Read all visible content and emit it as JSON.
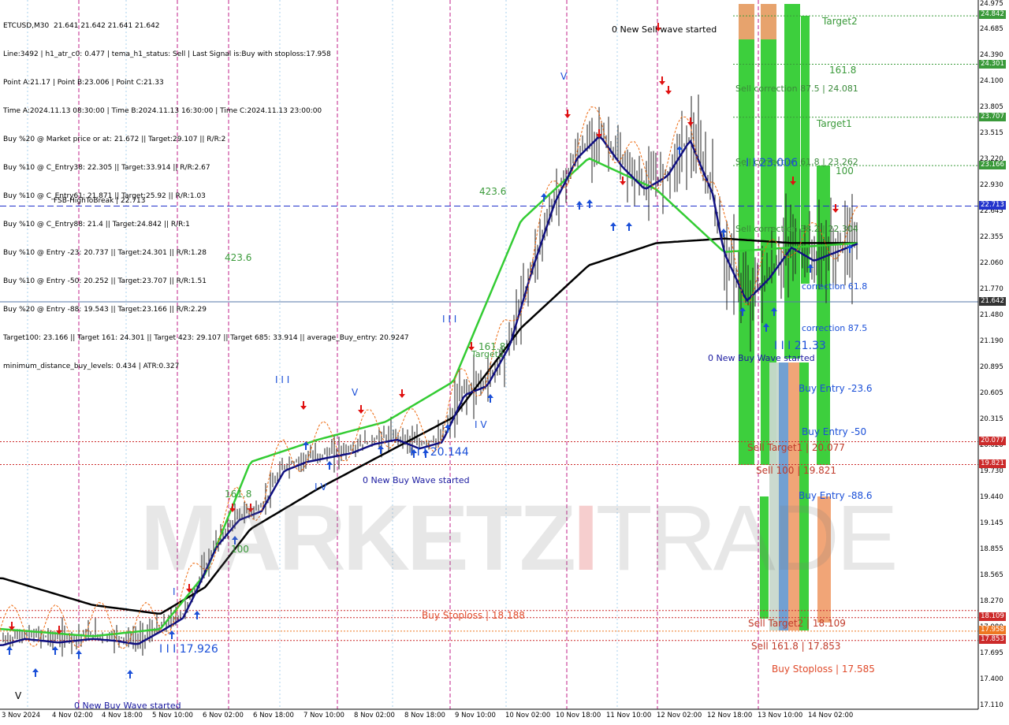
{
  "info_lines": [
    "ETCUSD,M30  21.641 21.642 21.641 21.642",
    "Line:3492 | h1_atr_c0: 0.477 | tema_h1_status: Sell | Last Signal is:Buy with stoploss:17.958",
    "Point A:21.17 | Point B:23.006 | Point C:21.33",
    "Time A:2024.11.13 08:30:00 | Time B:2024.11.13 16:30:00 | Time C:2024.11.13 23:00:00",
    "Buy %20 @ Market price or at: 21.672 || Target:29.107 || R/R:2",
    "Buy %10 @ C_Entry38: 22.305 || Target:33.914 || R/R:2.67",
    "Buy %10 @ C_Entry61: 21.871 || Target:25.92 || R/R:1.03",
    "Buy %10 @ C_Entry88: 21.4 || Target:24.842 || R/R:1",
    "Buy %10 @ Entry -23: 20.737 || Target:24.301 || R/R:1.28",
    "Buy %10 @ Entry -50: 20.252 || Target:23.707 || R/R:1.51",
    "Buy %20 @ Entry -88: 19.543 || Target:23.166 || R/R:2.29",
    "Target100: 23.166 || Target 161: 24.301 || Target 423: 29.107 || Target 685: 33.914 || average_Buy_entry: 20.9247",
    "minimum_distance_buy_levels: 0.434 | ATR:0.327"
  ],
  "y_axis": [
    "24.975",
    "24.685",
    "24.390",
    "24.100",
    "23.805",
    "23.515",
    "23.220",
    "22.930",
    "22.645",
    "22.355",
    "22.060",
    "21.770",
    "21.480",
    "21.190",
    "20.895",
    "20.605",
    "20.315",
    "20.020",
    "19.730",
    "19.440",
    "19.145",
    "18.855",
    "18.565",
    "18.270",
    "17.980",
    "17.695",
    "17.400",
    "17.110"
  ],
  "x_axis": [
    "3 Nov 2024",
    "4 Nov 02:00",
    "4 Nov 18:00",
    "5 Nov 10:00",
    "6 Nov 02:00",
    "6 Nov 18:00",
    "7 Nov 10:00",
    "8 Nov 02:00",
    "8 Nov 18:00",
    "9 Nov 10:00",
    "10 Nov 02:00",
    "10 Nov 18:00",
    "11 Nov 10:00",
    "12 Nov 02:00",
    "12 Nov 18:00",
    "13 Nov 10:00",
    "14 Nov 02:00"
  ],
  "price_tags": [
    {
      "value": "24.842",
      "color": "#3a9a3a"
    },
    {
      "value": "24.301",
      "color": "#3a9a3a"
    },
    {
      "value": "23.707",
      "color": "#3a9a3a"
    },
    {
      "value": "23.166",
      "color": "#3a9a3a"
    },
    {
      "value": "22.713",
      "color": "#2233cc"
    },
    {
      "value": "21.642",
      "color": "#333333"
    },
    {
      "value": "20.077",
      "color": "#cc2a2a"
    },
    {
      "value": "19.821",
      "color": "#cc2a2a"
    },
    {
      "value": "18.109",
      "color": "#cc2a2a"
    },
    {
      "value": "17.958",
      "color": "#ee7722"
    },
    {
      "value": "17.853",
      "color": "#cc2a2a"
    }
  ],
  "annotations": {
    "new_sell_wave": "0 New Sell wave started",
    "target2": "Target2",
    "fib_161_top": "161.8",
    "sell_corr_875": "Sell correction 87.5 | 24.081",
    "target1": "Target1",
    "sell_corr_61": "Sell correction 61.8 | 23.262",
    "point_b": "I I 23.006",
    "fib_100": "100",
    "fsb": "FSB-HighToBreak | 22.713",
    "fib_4236_a": "423.6",
    "fib_4236_b": "423.6",
    "sell_corr_382": "Sell correction 38.2 | 22.304",
    "corr_618": "correction 61.8",
    "corr_875": "correction 87.5",
    "point_c": "I I I 21.33",
    "new_buy_wave_3": "0 New Buy Wave started",
    "buy_entry_23": "Buy Entry -23.6",
    "buy_entry_50": "Buy Entry -50",
    "sell_target1": "Sell Target1 | 20.077",
    "sell_100": "Sell 100 | 19.821",
    "buy_entry_88": "Buy Entry -88.6",
    "buy_stoploss_left": "Buy Stoploss | 18.188",
    "sell_target2": "Sell Target2 | 18.109",
    "sell_1618": "Sell 161.8 | 17.853",
    "buy_stoploss_right": "Buy Stoploss | 17.585",
    "fib_1618_mid": "161.8",
    "target2_mid": "Target2",
    "wave_iii_mid": "I I I",
    "wave_iv_mid": "I V",
    "wave_v_mid": "V",
    "wave_iii_left": "I I I",
    "wave_iv_left": "I V",
    "val_20144": "I I I 20.144",
    "new_buy_wave_2": "0 New Buy Wave started",
    "fib_1618_left": "161.8",
    "fib_100_left": "100",
    "val_17926": "I I I 17.926",
    "wave_i": "I",
    "new_buy_wave_1": "0 New Buy Wave started",
    "wave_v_bottom": "V",
    "wave_v_top": "V"
  },
  "watermark": {
    "part1": "MARKETZ",
    "part2": "I",
    "part3": "TRADE"
  },
  "colors": {
    "green_bar": "#33cc33",
    "orange_bar": "#f0a070",
    "ma_black": "#000000",
    "ma_green": "#33cc33",
    "ma_navy": "#101080",
    "buy_arrow": "#1a4fd8",
    "sell_arrow": "#e01010"
  },
  "chart_data": {
    "type": "line",
    "title": "ETCUSD,M30",
    "ylim": [
      17.11,
      24.975
    ],
    "horizontal_levels": [
      24.842,
      24.301,
      23.707,
      23.166,
      22.713,
      21.642,
      20.077,
      19.821,
      18.188,
      18.109,
      17.958,
      17.853
    ],
    "series": [
      {
        "x": [
          0,
          2,
          5,
          8,
          10,
          12,
          14,
          16,
          17,
          19,
          21,
          23,
          25,
          27,
          29,
          31,
          33,
          35,
          37,
          39,
          41,
          43,
          45,
          47,
          49,
          51,
          53,
          55,
          57,
          59,
          61,
          63,
          64,
          66,
          68,
          70,
          72,
          74,
          76
        ],
        "values": [
          17.85,
          17.92,
          17.88,
          17.92,
          17.9,
          17.86,
          18.0,
          18.15,
          18.4,
          18.95,
          19.25,
          19.35,
          19.8,
          19.9,
          19.95,
          20.0,
          20.1,
          20.15,
          20.05,
          20.12,
          20.65,
          20.75,
          21.2,
          22.05,
          22.8,
          23.3,
          23.55,
          23.2,
          22.95,
          23.1,
          23.5,
          22.9,
          22.25,
          21.7,
          21.95,
          22.3,
          22.15,
          22.25,
          22.35
        ]
      },
      {
        "name": "MA black",
        "x": [
          0,
          8,
          14,
          18,
          22,
          28,
          34,
          40,
          46,
          52,
          58,
          64,
          70,
          76
        ],
        "values": [
          18.55,
          18.25,
          18.15,
          18.45,
          19.1,
          19.55,
          19.95,
          20.35,
          21.35,
          22.05,
          22.3,
          22.35,
          22.3,
          22.3
        ]
      },
      {
        "name": "MA green",
        "x": [
          0,
          8,
          14,
          18,
          22,
          28,
          34,
          40,
          46,
          52,
          58,
          64,
          70,
          76
        ],
        "values": [
          17.98,
          17.9,
          17.98,
          18.6,
          19.85,
          20.1,
          20.3,
          20.75,
          22.55,
          23.25,
          22.9,
          22.2,
          22.25,
          22.3
        ]
      }
    ]
  }
}
